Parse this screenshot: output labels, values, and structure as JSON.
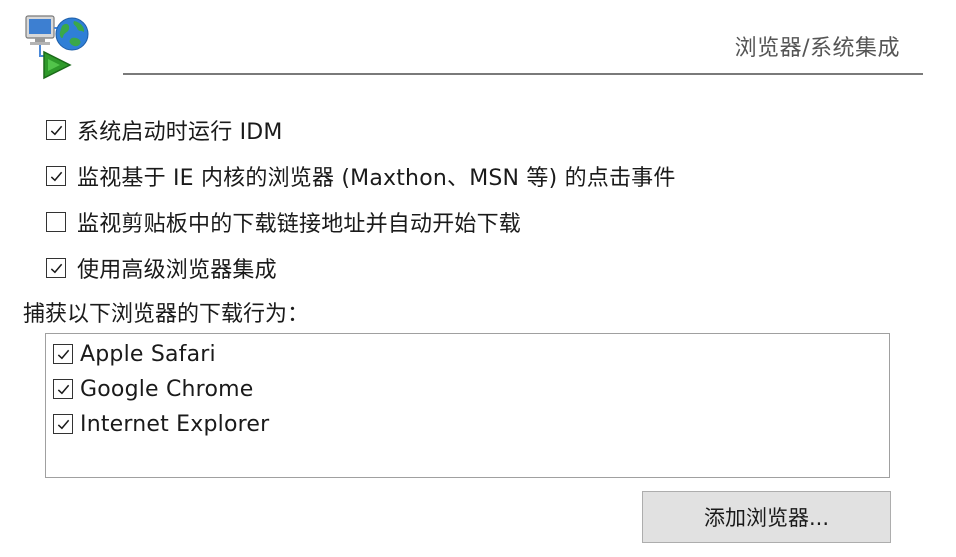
{
  "header": {
    "icon": "idm-browser-integration-icon",
    "title": "浏览器/系统集成"
  },
  "options": [
    {
      "label": "系统启动时运行 IDM",
      "checked": true
    },
    {
      "label": "监视基于 IE 内核的浏览器 (Maxthon、MSN 等) 的点击事件",
      "checked": true
    },
    {
      "label": "监视剪贴板中的下载链接地址并自动开始下载",
      "checked": false
    },
    {
      "label": "使用高级浏览器集成",
      "checked": true
    }
  ],
  "capture": {
    "label": "捕获以下浏览器的下载行为：",
    "browsers": [
      {
        "label": "Apple Safari",
        "checked": true
      },
      {
        "label": "Google Chrome",
        "checked": true
      },
      {
        "label": "Internet Explorer",
        "checked": true
      }
    ]
  },
  "add_button": {
    "label": "添加浏览器..."
  }
}
